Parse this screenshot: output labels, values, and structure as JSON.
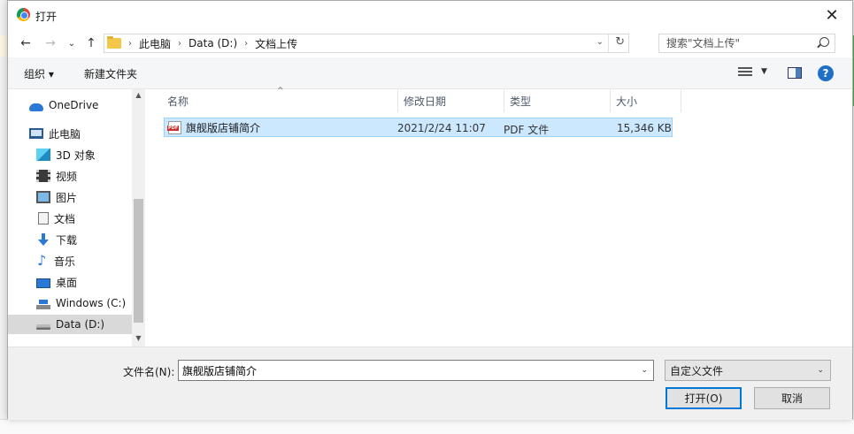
{
  "window": {
    "title": "打开",
    "close_glyph": "✕"
  },
  "nav_buttons": {
    "back": "←",
    "forward": "→",
    "recent": "⌄",
    "up": "↑"
  },
  "address": {
    "crumbs": [
      "此电脑",
      "Data (D:)",
      "文档上传"
    ],
    "separator": "›",
    "dropdown_glyph": "⌄",
    "refresh_glyph": "↻"
  },
  "search": {
    "placeholder": "搜索\"文档上传\""
  },
  "toolbar": {
    "organize": "组织 ▾",
    "new_folder": "新建文件夹",
    "view_dropdown": "▼",
    "help": "?"
  },
  "sidebar": {
    "items": [
      {
        "label": "OneDrive",
        "icon": "cloud-icon"
      },
      {
        "label": "此电脑",
        "icon": "computer-icon"
      },
      {
        "label": "3D 对象",
        "icon": "3d-objects-icon"
      },
      {
        "label": "视频",
        "icon": "video-icon"
      },
      {
        "label": "图片",
        "icon": "pictures-icon"
      },
      {
        "label": "文档",
        "icon": "documents-icon"
      },
      {
        "label": "下载",
        "icon": "download-icon"
      },
      {
        "label": "音乐",
        "icon": "music-icon"
      },
      {
        "label": "桌面",
        "icon": "desktop-icon"
      },
      {
        "label": "Windows (C:)",
        "icon": "windows-drive-icon"
      },
      {
        "label": "Data (D:)",
        "icon": "drive-icon",
        "selected": true
      }
    ],
    "scroll_up_glyph": "▲",
    "scroll_down_glyph": "▼"
  },
  "columns": {
    "name": "名称",
    "modified": "修改日期",
    "type": "类型",
    "size": "大小",
    "sort_glyph": "^"
  },
  "files": [
    {
      "name": "旗舰版店铺简介",
      "modified": "2021/2/24 11:07",
      "type": "PDF 文件",
      "size": "15,346 KB",
      "icon": "pdf-file-icon"
    }
  ],
  "footer": {
    "filename_label": "文件名(N):",
    "filename_value": "旗舰版店铺简介",
    "filetype_value": "自定义文件",
    "dropdown_glyph": "⌄",
    "open_button": "打开(O)",
    "cancel_button": "取消"
  },
  "colors": {
    "selection_bg": "#cce8ff",
    "accent": "#0078d7"
  }
}
